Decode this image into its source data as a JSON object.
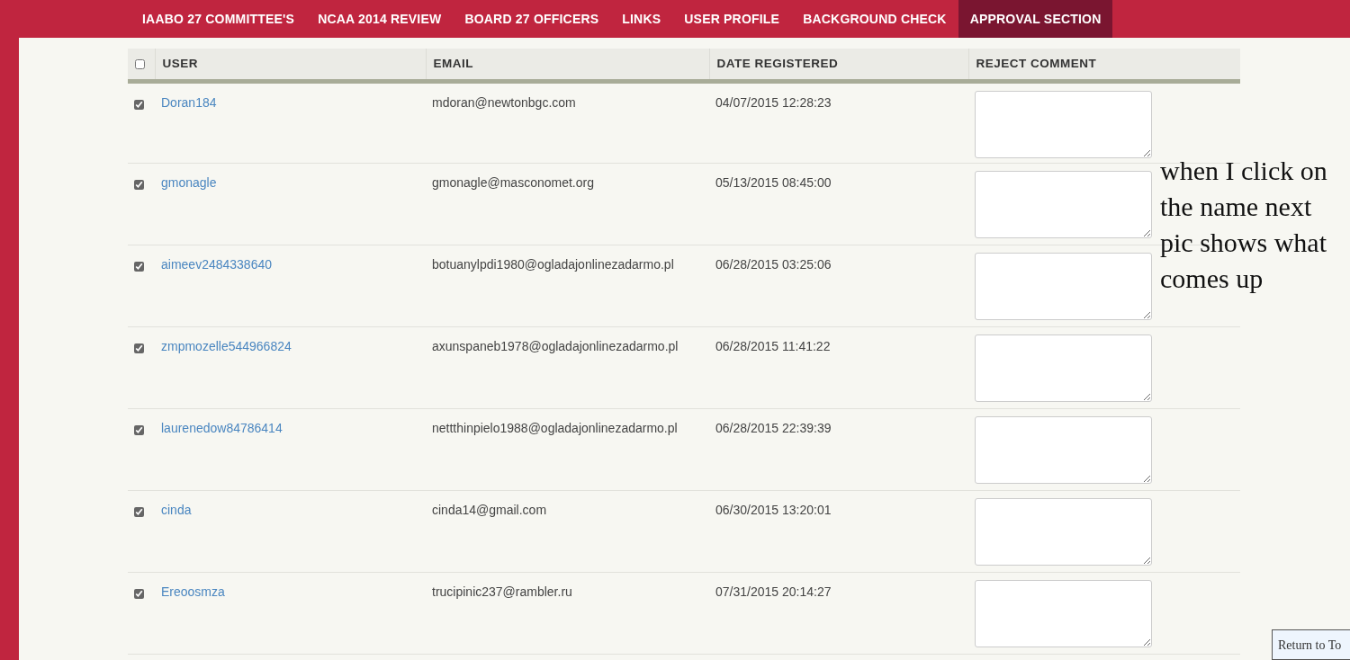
{
  "nav": [
    {
      "label": "IAABO 27 COMMITTEE'S",
      "selected": false
    },
    {
      "label": "NCAA 2014 REVIEW",
      "selected": false
    },
    {
      "label": "BOARD 27 OFFICERS",
      "selected": false
    },
    {
      "label": "LINKS",
      "selected": false
    },
    {
      "label": "USER PROFILE",
      "selected": false
    },
    {
      "label": "BACKGROUND CHECK",
      "selected": false
    },
    {
      "label": "APPROVAL SECTION",
      "selected": true
    }
  ],
  "table": {
    "select_all": {
      "checked": false
    },
    "columns": [
      "USER",
      "EMAIL",
      "DATE REGISTERED",
      "REJECT COMMENT"
    ],
    "rows": [
      {
        "checked": true,
        "user": "Doran184",
        "email": "mdoran@newtonbgc.com",
        "date": "04/07/2015 12:28:23"
      },
      {
        "checked": true,
        "user": "gmonagle",
        "email": "gmonagle@masconomet.org",
        "date": "05/13/2015 08:45:00"
      },
      {
        "checked": true,
        "user": "aimeev2484338640",
        "email": "botuanylpdi1980@ogladajonlinezadarmo.pl",
        "date": "06/28/2015 03:25:06"
      },
      {
        "checked": true,
        "user": "zmpmozelle544966824",
        "email": "axunspaneb1978@ogladajonlinezadarmo.pl",
        "date": "06/28/2015 11:41:22"
      },
      {
        "checked": true,
        "user": "laurenedow84786414",
        "email": "nettthinpielo1988@ogladajonlinezadarmo.pl",
        "date": "06/28/2015 22:39:39"
      },
      {
        "checked": true,
        "user": "cinda",
        "email": "cinda14@gmail.com",
        "date": "06/30/2015 13:20:01"
      },
      {
        "checked": true,
        "user": "Ereoosmza",
        "email": "trucipinic237@rambler.ru",
        "date": "07/31/2015 20:14:27"
      }
    ]
  },
  "annotation": "when I click on the name next pic shows what comes up",
  "return_button": "Return to To"
}
